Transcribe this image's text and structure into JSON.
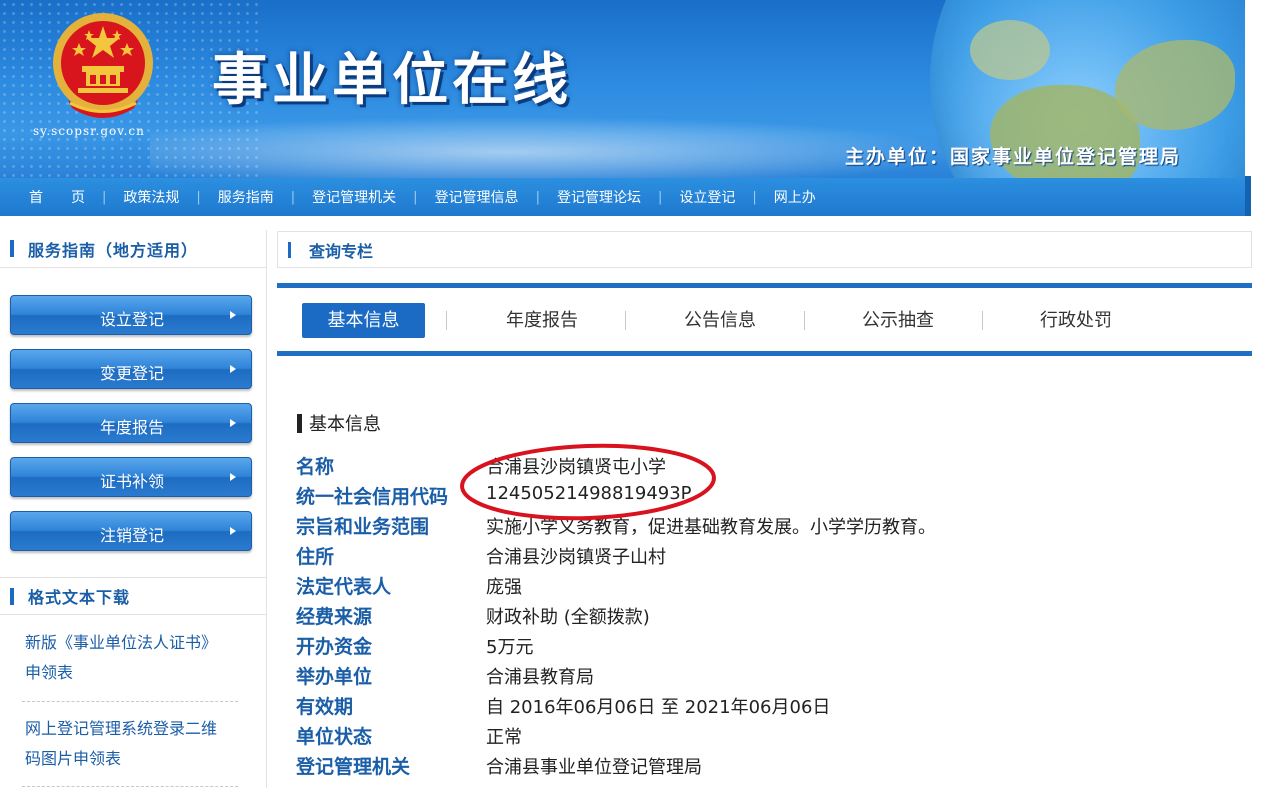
{
  "banner": {
    "site_title": "事业单位在线",
    "site_url": "sy.scopsr.gov.cn",
    "host_label": "主办单位：国家事业单位登记管理局",
    "emblem_icon": "national-emblem-icon"
  },
  "nav": {
    "items": [
      {
        "label": "首　　页"
      },
      {
        "label": "政策法规"
      },
      {
        "label": "服务指南"
      },
      {
        "label": "登记管理机关"
      },
      {
        "label": "登记管理信息"
      },
      {
        "label": "登记管理论坛"
      },
      {
        "label": "设立登记"
      },
      {
        "label": "网上办"
      }
    ],
    "separator": "|"
  },
  "sidebar": {
    "service_title": "服务指南（地方适用）",
    "buttons": [
      {
        "label": "设立登记"
      },
      {
        "label": "变更登记"
      },
      {
        "label": "年度报告"
      },
      {
        "label": "证书补领"
      },
      {
        "label": "注销登记"
      }
    ],
    "download_title": "格式文本下载",
    "downloads": [
      {
        "line1": "新版《事业单位法人证书》",
        "line2": "申领表"
      },
      {
        "line1": "网上登记管理系统登录二维",
        "line2": "码图片申领表"
      }
    ]
  },
  "main": {
    "query_title": "查询专栏",
    "tabs": [
      {
        "label": "基本信息",
        "active": true
      },
      {
        "label": "年度报告",
        "active": false
      },
      {
        "label": "公告信息",
        "active": false
      },
      {
        "label": "公示抽查",
        "active": false
      },
      {
        "label": "行政处罚",
        "active": false
      }
    ],
    "section_title": "基本信息",
    "rows": [
      {
        "label": "名称",
        "value": "合浦县沙岗镇贤屯小学"
      },
      {
        "label": "统一社会信用代码",
        "value": "12450521498819493P"
      },
      {
        "label": "宗旨和业务范围",
        "value": "实施小学义务教育，促进基础教育发展。小学学历教育。"
      },
      {
        "label": "住所",
        "value": "合浦县沙岗镇贤子山村"
      },
      {
        "label": "法定代表人",
        "value": "庞强"
      },
      {
        "label": "经费来源",
        "value": "财政补助 (全额拨款)"
      },
      {
        "label": "开办资金",
        "value": "5万元"
      },
      {
        "label": "举办单位",
        "value": "合浦县教育局"
      },
      {
        "label": "有效期",
        "value": "自 2016年06月06日 至 2021年06月06日"
      },
      {
        "label": "单位状态",
        "value": "正常"
      },
      {
        "label": "登记管理机关",
        "value": "合浦县事业单位登记管理局"
      }
    ]
  },
  "colors": {
    "banner_blue": "#2c8ae0",
    "nav_blue": "#1f79cf",
    "label_blue": "#1b5ea8",
    "active_tab": "#1b6ac4",
    "highlight_red": "#d8121e"
  }
}
